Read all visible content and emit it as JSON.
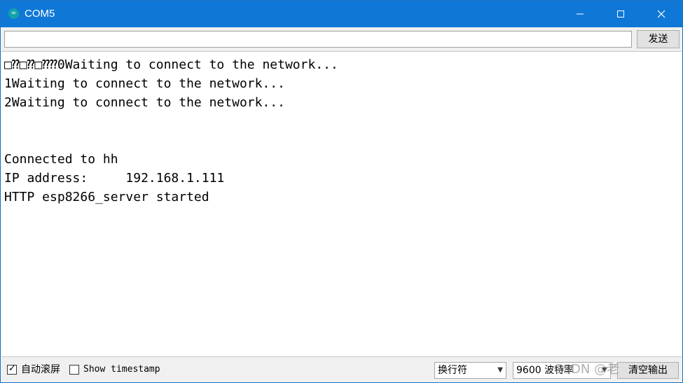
{
  "window": {
    "title": "COM5",
    "icon_glyph": "∞",
    "controls": {
      "minimize_glyph": "—",
      "maximize_glyph": "☐",
      "close_glyph": "✕"
    }
  },
  "send_row": {
    "input_value": "",
    "send_label": "发送"
  },
  "output_lines": [
    "□⁇□⁇□⁇⁇0Waiting to connect to the network...",
    "1Waiting to connect to the network...",
    "2Waiting to connect to the network...",
    "",
    "",
    "Connected to hh",
    "IP address:     192.168.1.111",
    "HTTP esp8266_server started"
  ],
  "status_bar": {
    "autoscroll_label": "自动滚屏",
    "autoscroll_checked": true,
    "timestamp_label": "Show timestamp",
    "timestamp_checked": false,
    "line_ending_value": "换行符",
    "baud_value": "9600 波特率",
    "clear_label": "清空输出"
  },
  "watermark": "CSDN @老"
}
